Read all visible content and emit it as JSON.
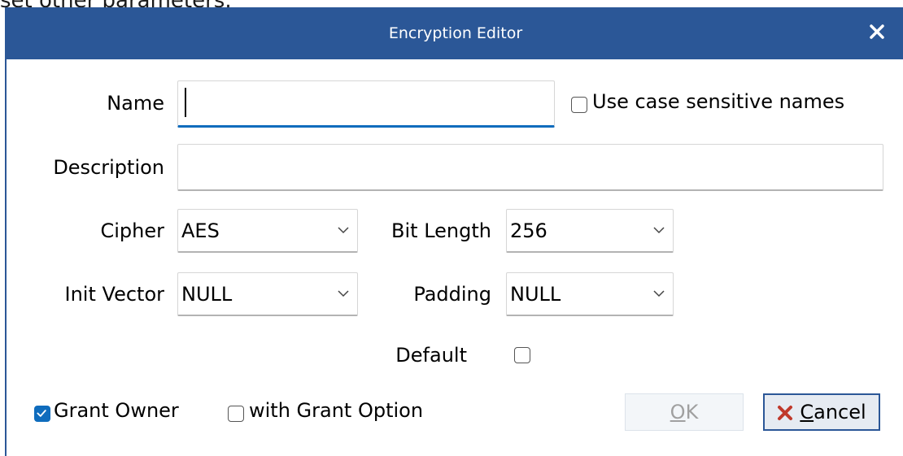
{
  "background_text": "set other parameters.",
  "window": {
    "title": "Encryption Editor",
    "close_icon": "close-icon",
    "accent_color": "#2b5797"
  },
  "form": {
    "name_label": "Name",
    "name_value": "",
    "case_sensitive_label": "Use case sensitive names",
    "case_sensitive_checked": false,
    "description_label": "Description",
    "description_value": "",
    "cipher_label": "Cipher",
    "cipher_value": "AES",
    "bit_length_label": "Bit Length",
    "bit_length_value": "256",
    "init_vector_label": "Init Vector",
    "init_vector_value": "NULL",
    "padding_label": "Padding",
    "padding_value": "NULL",
    "default_label": "Default",
    "default_checked": false
  },
  "footer": {
    "grant_owner_label": "Grant Owner",
    "grant_owner_checked": true,
    "grant_option_label": "with Grant Option",
    "grant_option_checked": false,
    "ok_first": "O",
    "ok_rest": "K",
    "cancel_first": "C",
    "cancel_rest": "ancel",
    "cancel_icon": "x-cancel-icon",
    "cancel_icon_color": "#c0392b"
  }
}
